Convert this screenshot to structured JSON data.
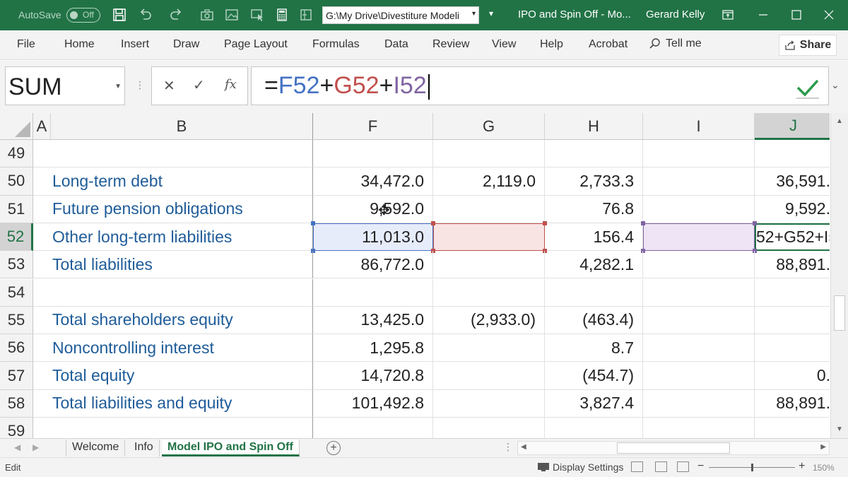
{
  "titlebar": {
    "autosave_label": "AutoSave",
    "autosave_state": "Off",
    "file_path": "G:\\My Drive\\Divestiture Modeli",
    "document_title": "IPO and Spin Off - Mo...",
    "user_name": "Gerard Kelly"
  },
  "ribbon": {
    "tabs": [
      "File",
      "Home",
      "Insert",
      "Draw",
      "Page Layout",
      "Formulas",
      "Data",
      "Review",
      "View",
      "Help",
      "Acrobat"
    ],
    "tell_me": "Tell me",
    "share": "Share"
  },
  "formula_bar": {
    "name_box": "SUM",
    "cancel_symbol": "✕",
    "enter_symbol": "✓",
    "fx_symbol": "fx",
    "formula_parts": [
      "=",
      "F52",
      "+",
      "G52",
      "+",
      "I52"
    ],
    "colors": {
      "F52": "#4472c4",
      "G52": "#c0504d",
      "I52": "#8064a2"
    }
  },
  "columns": [
    "A",
    "B",
    "F",
    "G",
    "H",
    "I",
    "J"
  ],
  "active_column": "J",
  "rows": [
    {
      "num": "49",
      "label": "",
      "F": "",
      "G": "",
      "H": "",
      "I": "",
      "J": ""
    },
    {
      "num": "50",
      "label": "Long-term debt",
      "F": "34,472.0",
      "G": "2,119.0",
      "H": "2,733.3",
      "I": "",
      "J": "36,591."
    },
    {
      "num": "51",
      "label": "Future pension obligations",
      "F": "9,592.0",
      "G": "",
      "H": "76.8",
      "I": "",
      "J": "9,592."
    },
    {
      "num": "52",
      "label": "Other long-term liabilities",
      "F": "11,013.0",
      "G": "",
      "H": "156.4",
      "I": "",
      "J": "52+G52+I5"
    },
    {
      "num": "53",
      "label": "Total liabilities",
      "F": "86,772.0",
      "G": "",
      "H": "4,282.1",
      "I": "",
      "J": "88,891."
    },
    {
      "num": "54",
      "label": "",
      "F": "",
      "G": "",
      "H": "",
      "I": "",
      "J": ""
    },
    {
      "num": "55",
      "label": "Total shareholders equity",
      "F": "13,425.0",
      "G": "(2,933.0)",
      "H": "(463.4)",
      "I": "",
      "J": ""
    },
    {
      "num": "56",
      "label": "Noncontrolling interest",
      "F": "1,295.8",
      "G": "",
      "H": "8.7",
      "I": "",
      "J": ""
    },
    {
      "num": "57",
      "label": "Total equity",
      "F": "14,720.8",
      "G": "",
      "H": "(454.7)",
      "I": "",
      "J": "0."
    },
    {
      "num": "58",
      "label": "Total liabilities and equity",
      "F": "101,492.8",
      "G": "",
      "H": "3,827.4",
      "I": "",
      "J": "88,891."
    },
    {
      "num": "59",
      "label": "",
      "F": "",
      "G": "",
      "H": "",
      "I": "",
      "J": ""
    }
  ],
  "active_row": "52",
  "sheets": [
    "Welcome",
    "Info",
    "Model IPO and Spin Off"
  ],
  "active_sheet": "Model IPO and Spin Off",
  "status": {
    "mode": "Edit",
    "display_settings": "Display Settings",
    "zoom_level": "150%"
  }
}
